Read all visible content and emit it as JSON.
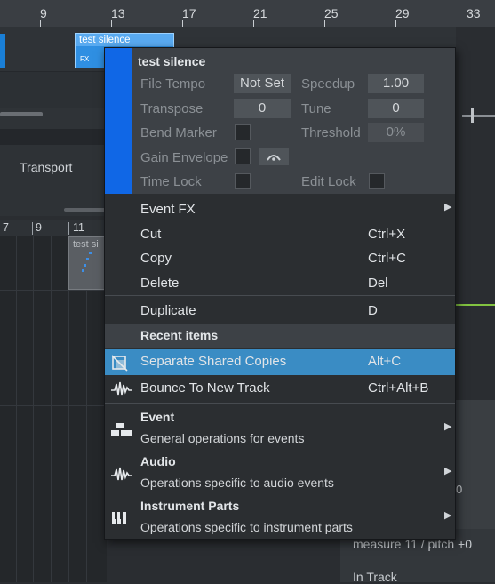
{
  "ruler": {
    "marks": [
      "9",
      "13",
      "17",
      "21",
      "25",
      "29",
      "33"
    ]
  },
  "clip": {
    "name": "test silence",
    "fx_label": "FX"
  },
  "panel": {
    "transport_label": "Transport"
  },
  "ruler2": {
    "marks": [
      "7",
      "9",
      "11"
    ]
  },
  "mini_clip": {
    "label": "test si"
  },
  "right": {
    "zero_label": "0",
    "measure_text": "measure 11 / pitch +0",
    "intrack_text": "In Track"
  },
  "menu": {
    "title": "test silence",
    "props": {
      "file_tempo_label": "File Tempo",
      "file_tempo_value": "Not Set",
      "speedup_label": "Speedup",
      "speedup_value": "1.00",
      "transpose_label": "Transpose",
      "transpose_value": "0",
      "tune_label": "Tune",
      "tune_value": "0",
      "bend_marker_label": "Bend Marker",
      "threshold_label": "Threshold",
      "threshold_value": "0%",
      "gain_envelope_label": "Gain Envelope",
      "time_lock_label": "Time Lock",
      "edit_lock_label": "Edit Lock"
    },
    "items": [
      {
        "label": "Event FX",
        "shortcut": ""
      },
      {
        "label": "Cut",
        "shortcut": "Ctrl+X"
      },
      {
        "label": "Copy",
        "shortcut": "Ctrl+C"
      },
      {
        "label": "Delete",
        "shortcut": "Del"
      },
      {
        "label": "Duplicate",
        "shortcut": "D"
      }
    ],
    "recent_header": "Recent items",
    "recent": [
      {
        "label": "Separate Shared Copies",
        "shortcut": "Alt+C",
        "icon": "separate-copies-icon"
      },
      {
        "label": "Bounce To New Track",
        "shortcut": "Ctrl+Alt+B",
        "icon": "waveform-icon"
      }
    ],
    "submenus": [
      {
        "title": "Event",
        "desc": "General operations for events",
        "icon": "event-blocks-icon"
      },
      {
        "title": "Audio",
        "desc": "Operations specific to audio events",
        "icon": "waveform-icon"
      },
      {
        "title": "Instrument Parts",
        "desc": "Operations specific to instrument parts",
        "icon": "piano-keys-icon"
      }
    ],
    "colors": {
      "accent": "#1067e6",
      "highlight": "#3a8cc4"
    }
  }
}
